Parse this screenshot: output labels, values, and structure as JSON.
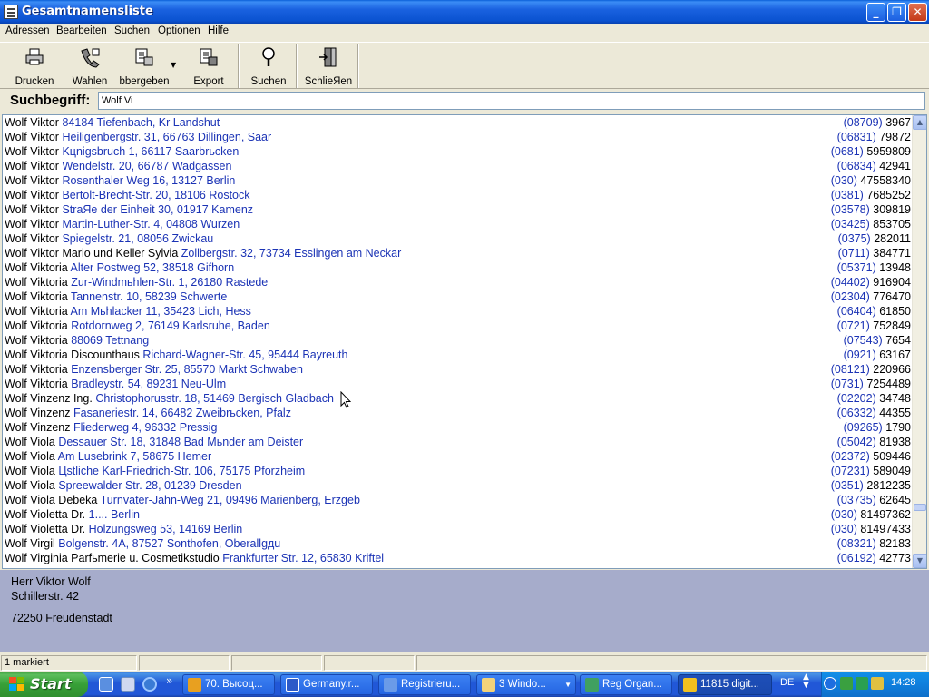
{
  "window": {
    "title": "Gesamtnamensliste",
    "minimize_glyph": "_",
    "maximize_glyph": "❐",
    "close_glyph": "✕"
  },
  "menu": [
    "Adressen",
    "Bearbeiten",
    "Suchen",
    "Optionen",
    "Hilfe"
  ],
  "toolbar": {
    "print": "Drucken",
    "dial": "Wahlen",
    "transfer": "bbergeben",
    "export": "Export",
    "search": "Suchen",
    "close": "SchlieЯen"
  },
  "search": {
    "label": "Suchbegriff:",
    "value": "Wolf Vi"
  },
  "entries": [
    {
      "name": "Wolf Viktor",
      "address": "84184 Tiefenbach, Kr Landshut",
      "area": "(08709)",
      "number": "3967"
    },
    {
      "name": "Wolf Viktor",
      "address": "Heiligenbergstr. 31, 66763 Dillingen, Saar",
      "area": "(06831)",
      "number": "79872"
    },
    {
      "name": "Wolf Viktor",
      "address": "Kцnigsbruch 1, 66117 Saarbrьcken",
      "area": "(0681)",
      "number": "5959809"
    },
    {
      "name": "Wolf Viktor",
      "address": "Wendelstr. 20, 66787 Wadgassen",
      "area": "(06834)",
      "number": "42941"
    },
    {
      "name": "Wolf Viktor",
      "address": "Rosenthaler Weg 16, 13127 Berlin",
      "area": "(030)",
      "number": "47558340"
    },
    {
      "name": "Wolf Viktor",
      "address": "Bertolt-Brecht-Str. 20, 18106 Rostock",
      "area": "(0381)",
      "number": "7685252"
    },
    {
      "name": "Wolf Viktor",
      "address": "StraЯe der Einheit 30, 01917 Kamenz",
      "area": "(03578)",
      "number": "309819"
    },
    {
      "name": "Wolf Viktor",
      "address": "Martin-Luther-Str. 4, 04808 Wurzen",
      "area": "(03425)",
      "number": "853705"
    },
    {
      "name": "Wolf Viktor",
      "address": "Spiegelstr. 21, 08056 Zwickau",
      "area": "(0375)",
      "number": "282011"
    },
    {
      "name": "Wolf Viktor Mario und Keller Sylvia",
      "address": "Zollbergstr. 32, 73734 Esslingen am Neckar",
      "area": "(0711)",
      "number": "384771"
    },
    {
      "name": "Wolf Viktoria",
      "address": "Alter Postweg 52, 38518 Gifhorn",
      "area": "(05371)",
      "number": "13948"
    },
    {
      "name": "Wolf Viktoria",
      "address": "Zur-Windmьhlen-Str. 1, 26180 Rastede",
      "area": "(04402)",
      "number": "916904"
    },
    {
      "name": "Wolf Viktoria",
      "address": "Tannenstr. 10, 58239 Schwerte",
      "area": "(02304)",
      "number": "776470"
    },
    {
      "name": "Wolf Viktoria",
      "address": "Am Mьhlacker 11, 35423 Lich, Hess",
      "area": "(06404)",
      "number": "61850"
    },
    {
      "name": "Wolf Viktoria",
      "address": "Rotdornweg 2, 76149 Karlsruhe, Baden",
      "area": "(0721)",
      "number": "752849"
    },
    {
      "name": "Wolf Viktoria",
      "address": "88069 Tettnang",
      "area": "(07543)",
      "number": "7654"
    },
    {
      "name": "Wolf Viktoria Discounthaus",
      "address": "Richard-Wagner-Str. 45, 95444 Bayreuth",
      "area": "(0921)",
      "number": "63167"
    },
    {
      "name": "Wolf Viktoria",
      "address": "Enzensberger Str. 25, 85570 Markt Schwaben",
      "area": "(08121)",
      "number": "220966"
    },
    {
      "name": "Wolf Viktoria",
      "address": "Bradleystr. 54, 89231 Neu-Ulm",
      "area": "(0731)",
      "number": "7254489"
    },
    {
      "name": "Wolf Vinzenz Ing.",
      "address": "Christophorusstr. 18, 51469 Bergisch Gladbach",
      "area": "(02202)",
      "number": "34748"
    },
    {
      "name": "Wolf Vinzenz",
      "address": "Fasaneriestr. 14, 66482 Zweibrьcken, Pfalz",
      "area": "(06332)",
      "number": "44355"
    },
    {
      "name": "Wolf Vinzenz",
      "address": "Fliederweg 4, 96332 Pressig",
      "area": "(09265)",
      "number": "1790"
    },
    {
      "name": "Wolf Viola",
      "address": "Dessauer Str. 18, 31848 Bad Mьnder am Deister",
      "area": "(05042)",
      "number": "81938"
    },
    {
      "name": "Wolf Viola",
      "address": "Am Lusebrink 7, 58675 Hemer",
      "area": "(02372)",
      "number": "509446"
    },
    {
      "name": "Wolf Viola",
      "address": "Цstliche Karl-Friedrich-Str. 106, 75175 Pforzheim",
      "area": "(07231)",
      "number": "589049"
    },
    {
      "name": "Wolf Viola",
      "address": "Spreewalder Str. 28, 01239 Dresden",
      "area": "(0351)",
      "number": "2812235"
    },
    {
      "name": "Wolf Viola Debeka",
      "address": "Turnvater-Jahn-Weg 21, 09496 Marienberg, Erzgeb",
      "area": "(03735)",
      "number": "62645"
    },
    {
      "name": "Wolf Violetta Dr.",
      "address": "1.... Berlin",
      "area": "(030)",
      "number": "81497362"
    },
    {
      "name": "Wolf Violetta Dr.",
      "address": "Holzungsweg 53, 14169 Berlin",
      "area": "(030)",
      "number": "81497433"
    },
    {
      "name": "Wolf Virgil",
      "address": "Bolgenstr. 4A, 87527 Sonthofen, Oberallgдu",
      "area": "(08321)",
      "number": "82183"
    },
    {
      "name": "Wolf Virginia Parfьmerie u. Cosmetikstudio",
      "address": "Frankfurter Str. 12, 65830 Kriftel",
      "area": "(06192)",
      "number": "42773"
    }
  ],
  "detail": {
    "salutation": "Herr Viktor Wolf",
    "street": "Schillerstr. 42",
    "city": "72250 Freudenstadt"
  },
  "status": {
    "selected": "1 markiert"
  },
  "taskbar": {
    "start": "Start",
    "overflow": "»",
    "tasks": [
      "70. Высоц...",
      "Germany.r...",
      "Registrieru...",
      "3 Windo...",
      "Reg Organ...",
      "11815 digit..."
    ],
    "language": "DE",
    "clock": "14:28"
  },
  "colors": {
    "address_link": "#1B33B5",
    "detail_panel": "#A6ACCB",
    "titlebar": "#0A52D0",
    "start_button": "#37A037"
  }
}
